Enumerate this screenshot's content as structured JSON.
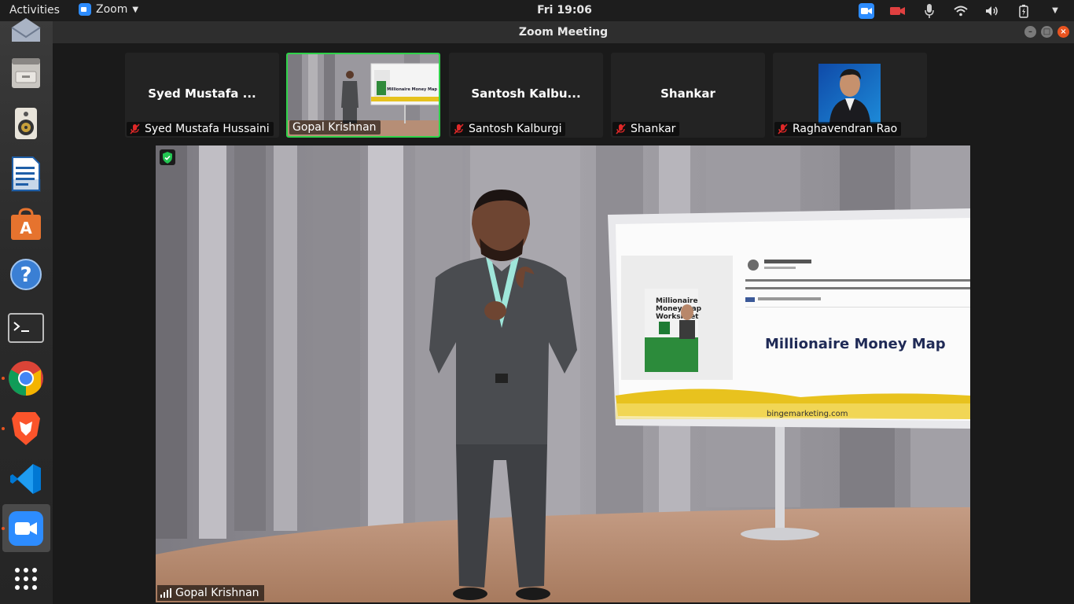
{
  "topbar": {
    "activities": "Activities",
    "app_name": "Zoom",
    "clock": "Fri 19:06"
  },
  "window": {
    "title": "Zoom Meeting"
  },
  "dock": {
    "items": [
      "mail-icon",
      "file-manager-icon",
      "speaker-icon",
      "writer-icon",
      "software-store-icon",
      "help-icon",
      "terminal-icon",
      "chrome-icon",
      "brave-icon",
      "vscode-icon",
      "zoom-icon",
      "app-grid-icon"
    ]
  },
  "participants": [
    {
      "display": "Syed Mustafa ...",
      "label": "Syed Mustafa Hussaini",
      "muted": true
    },
    {
      "display": "",
      "label": "Gopal Krishnan",
      "muted": false,
      "active": true
    },
    {
      "display": "Santosh Kalbu...",
      "label": "Santosh Kalburgi",
      "muted": true
    },
    {
      "display": "Shankar",
      "label": "Shankar",
      "muted": true
    },
    {
      "display": "",
      "label": "Raghavendran Rao",
      "muted": true
    }
  ],
  "main_video": {
    "speaker": "Gopal Krishnan",
    "screen_title": "Millionaire Money Map",
    "screen_product": "Millionaire Money Map Worksheet",
    "screen_url": "bingemarketing.com"
  },
  "colors": {
    "active_border": "#2fd24a",
    "zoom_blue": "#2d8cff",
    "ubuntu_orange": "#e95420",
    "muted_red": "#e02828"
  }
}
